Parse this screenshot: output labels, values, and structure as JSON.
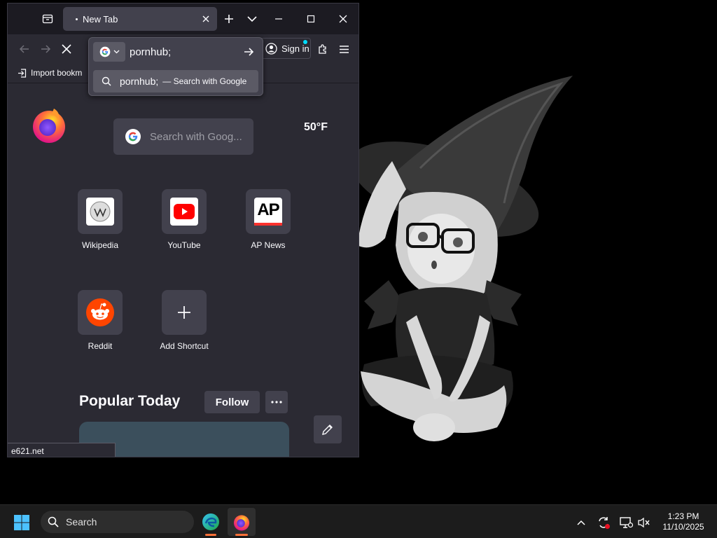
{
  "browser": {
    "tab": {
      "title": "New Tab"
    },
    "signin_label": "Sign in",
    "bookmarks": {
      "import_label": "Import bookm"
    },
    "urlbar": {
      "value": "pornhub;",
      "suggestion_query": "pornhub;",
      "suggestion_action": "— Search with Google"
    },
    "newtab": {
      "search_placeholder": "Search with Goog...",
      "weather": "50°F",
      "shortcuts": [
        {
          "label": "Wikipedia",
          "icon": "wikipedia-icon"
        },
        {
          "label": "YouTube",
          "icon": "youtube-icon"
        },
        {
          "label": "AP News",
          "icon": "ap-news-icon",
          "icon_text": "AP"
        },
        {
          "label": "Reddit",
          "icon": "reddit-icon"
        },
        {
          "label": "Add Shortcut",
          "icon": "plus-icon"
        }
      ],
      "popular_title": "Popular Today",
      "follow_label": "Follow"
    },
    "status_url": "e621.net"
  },
  "taskbar": {
    "search_label": "Search",
    "time": "1:23 PM",
    "date": "11/10/2025"
  },
  "colors": {
    "accent": "#00ddff",
    "youtube": "#ff0000",
    "reddit": "#ff4500",
    "tab_bg": "#42414d",
    "window_bg": "#2b2a33"
  }
}
